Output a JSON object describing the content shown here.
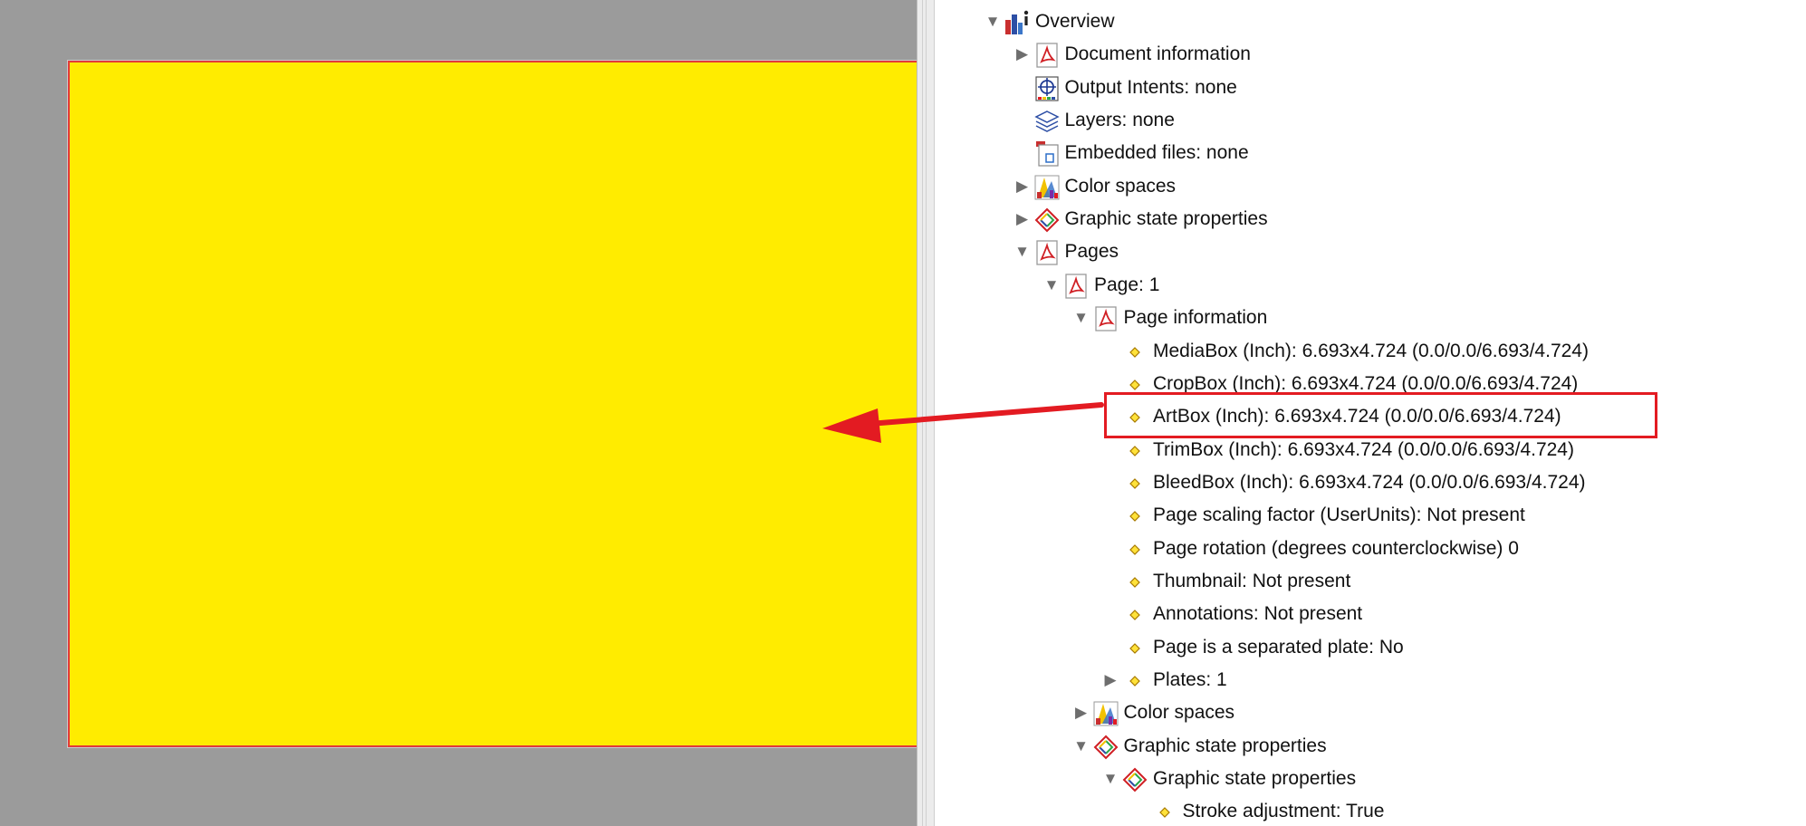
{
  "colors": {
    "preview_background": "#9b9b9b",
    "page_fill": "#ffec00",
    "page_border": "#e23a3a",
    "annotation_red": "#e31b22"
  },
  "tree": {
    "rows": [
      {
        "label": "Overview",
        "icon": "overview-chart-icon",
        "expand": "expanded"
      },
      {
        "label": "Document information",
        "icon": "pdf-document-icon",
        "expand": "collapsed"
      },
      {
        "label": "Output Intents: none",
        "icon": "output-intent-target-icon",
        "expand": "none"
      },
      {
        "label": "Layers: none",
        "icon": "layers-stack-icon",
        "expand": "none"
      },
      {
        "label": "Embedded files: none",
        "icon": "embedded-file-icon",
        "expand": "none"
      },
      {
        "label": "Color spaces",
        "icon": "color-spaces-icon",
        "expand": "collapsed"
      },
      {
        "label": "Graphic state properties",
        "icon": "graphic-state-diamond-icon",
        "expand": "collapsed"
      },
      {
        "label": "Pages",
        "icon": "pdf-document-icon",
        "expand": "expanded"
      },
      {
        "label": "Page: 1",
        "icon": "pdf-document-icon",
        "expand": "expanded"
      },
      {
        "label": "Page information",
        "icon": "pdf-document-icon",
        "expand": "expanded"
      },
      {
        "label": "MediaBox (Inch): 6.693x4.724 (0.0/0.0/6.693/4.724)",
        "icon": "property-diamond-icon",
        "expand": "none"
      },
      {
        "label": "CropBox (Inch): 6.693x4.724 (0.0/0.0/6.693/4.724)",
        "icon": "property-diamond-icon",
        "expand": "none"
      },
      {
        "label": "ArtBox (Inch): 6.693x4.724 (0.0/0.0/6.693/4.724)",
        "icon": "property-diamond-icon",
        "expand": "none"
      },
      {
        "label": "TrimBox (Inch): 6.693x4.724 (0.0/0.0/6.693/4.724)",
        "icon": "property-diamond-icon",
        "expand": "none"
      },
      {
        "label": "BleedBox (Inch): 6.693x4.724 (0.0/0.0/6.693/4.724)",
        "icon": "property-diamond-icon",
        "expand": "none"
      },
      {
        "label": "Page scaling factor (UserUnits): Not present",
        "icon": "property-diamond-icon",
        "expand": "none"
      },
      {
        "label": "Page rotation (degrees counterclockwise) 0",
        "icon": "property-diamond-icon",
        "expand": "none"
      },
      {
        "label": "Thumbnail: Not present",
        "icon": "property-diamond-icon",
        "expand": "none"
      },
      {
        "label": "Annotations: Not present",
        "icon": "property-diamond-icon",
        "expand": "none"
      },
      {
        "label": "Page is a separated plate: No",
        "icon": "property-diamond-icon",
        "expand": "none"
      },
      {
        "label": "Plates: 1",
        "icon": "property-diamond-icon",
        "expand": "collapsed"
      },
      {
        "label": "Color spaces",
        "icon": "color-spaces-icon",
        "expand": "collapsed"
      },
      {
        "label": "Graphic state properties",
        "icon": "graphic-state-diamond-icon",
        "expand": "expanded"
      },
      {
        "label": "Graphic state properties",
        "icon": "graphic-state-diamond-icon",
        "expand": "expanded"
      },
      {
        "label": "Stroke adjustment: True",
        "icon": "property-diamond-icon",
        "expand": "none"
      }
    ]
  }
}
